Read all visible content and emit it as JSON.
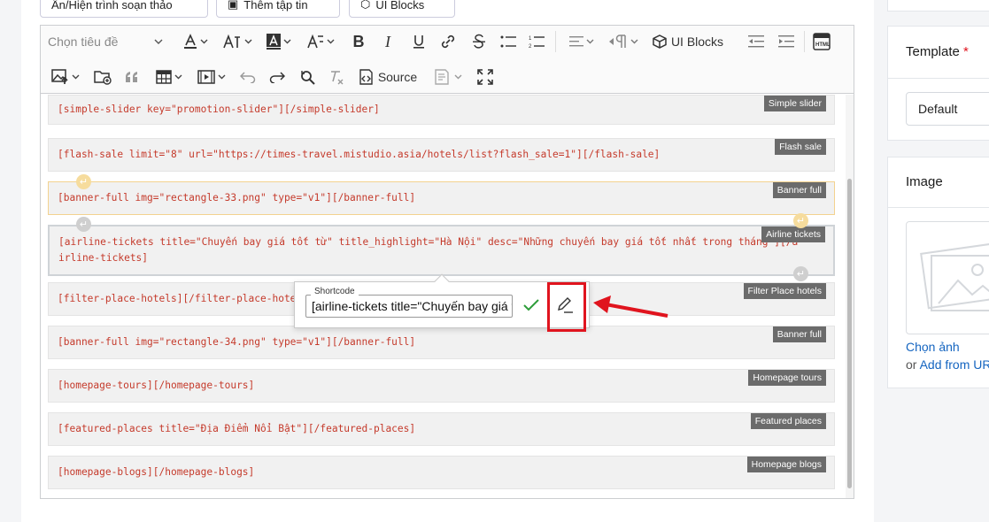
{
  "top_buttons": {
    "toggle_editor": "Ẩn/Hiện trình soạn thảo",
    "add_file": "Thêm tập tin",
    "ui_blocks": "UI Blocks"
  },
  "toolbar": {
    "heading_select": "Chọn tiêu đề",
    "ui_blocks_label": "UI Blocks",
    "source_label": "Source"
  },
  "shortcodes": [
    {
      "code": "[simple-slider key=\"promotion-slider\"][/simple-slider]",
      "tag": "Simple slider"
    },
    {
      "code": "[flash-sale limit=\"8\" url=\"https://times-travel.mistudio.asia/hotels/list?flash_sale=1\"][/flash-sale]",
      "tag": "Flash sale"
    },
    {
      "code": "[banner-full img=\"rectangle-33.png\" type=\"v1\"][/banner-full]",
      "tag": "Banner full"
    },
    {
      "code": "[airline-tickets title=\"Chuyến bay giá tốt từ\" title_highlight=\"Hà Nội\" desc=\"Những chuyến bay giá tốt nhất trong tháng\"][/airline-tickets]",
      "tag": "Airline tickets"
    },
    {
      "code": "[filter-place-hotels][/filter-place-hotels]",
      "tag": "Filter Place hotels"
    },
    {
      "code": "[banner-full img=\"rectangle-34.png\" type=\"v1\"][/banner-full]",
      "tag": "Banner full"
    },
    {
      "code": "[homepage-tours][/homepage-tours]",
      "tag": "Homepage tours"
    },
    {
      "code": "[featured-places title=\"Địa Điểm Nổi Bật\"][/featured-places]",
      "tag": "Featured places"
    },
    {
      "code": "[homepage-blogs][/homepage-blogs]",
      "tag": "Homepage blogs"
    }
  ],
  "popup": {
    "label": "Shortcode",
    "value": "[airline-tickets title=\"Chuyến bay giá tốt từ\""
  },
  "sidebar": {
    "template_label": "Template",
    "required_mark": "*",
    "template_value": "Default",
    "image_label": "Image",
    "choose_image": "Chọn ảnh",
    "or_text": "or",
    "add_from_url": "Add from URL"
  },
  "colors": {
    "accent_blue": "#1565c0",
    "shortcode_red": "#c53a2b",
    "annotation_red": "#e0141e",
    "check_green": "#2e9d3a"
  }
}
